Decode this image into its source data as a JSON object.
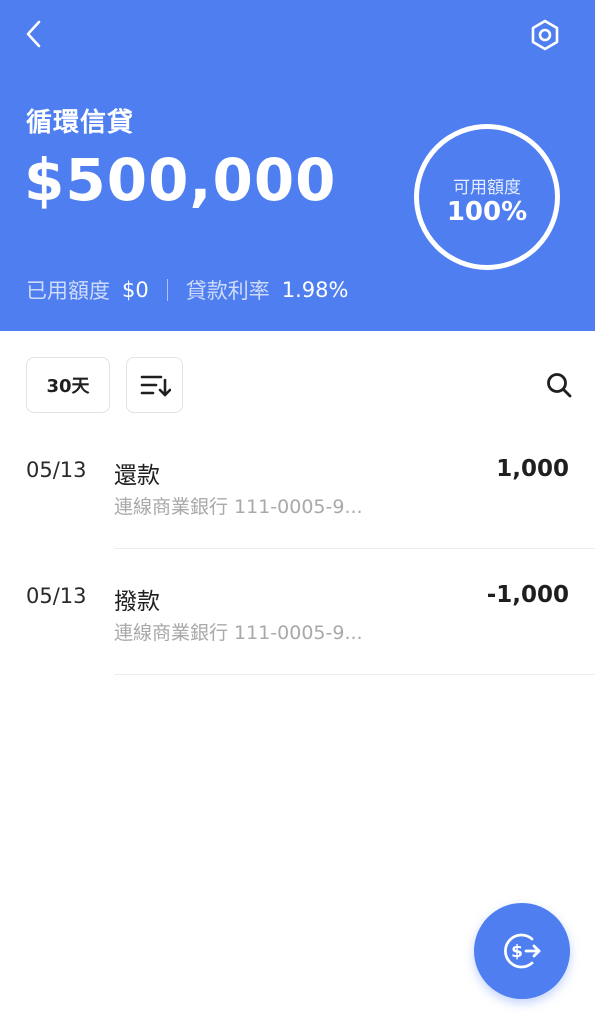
{
  "header": {
    "title": "循環信貸",
    "amount": "$500,000",
    "available_label": "可用額度",
    "available_percent": "100%",
    "used_label": "已用額度",
    "used_value": "$0",
    "rate_label": "貸款利率",
    "rate_value": "1.98%",
    "background_color": "#4f7ef0"
  },
  "icons": {
    "back": "chevron-left-icon",
    "settings": "hexagon-gear-icon",
    "sort": "sort-descending-icon",
    "search": "search-icon",
    "transfer": "dollar-arrow-icon"
  },
  "filters": {
    "days_label": "30天"
  },
  "transactions": [
    {
      "date": "05/13",
      "name": "還款",
      "description": "連線商業銀行 111-0005-9...",
      "amount": "1,000"
    },
    {
      "date": "05/13",
      "name": "撥款",
      "description": "連線商業銀行 111-0005-9...",
      "amount": "-1,000"
    }
  ]
}
